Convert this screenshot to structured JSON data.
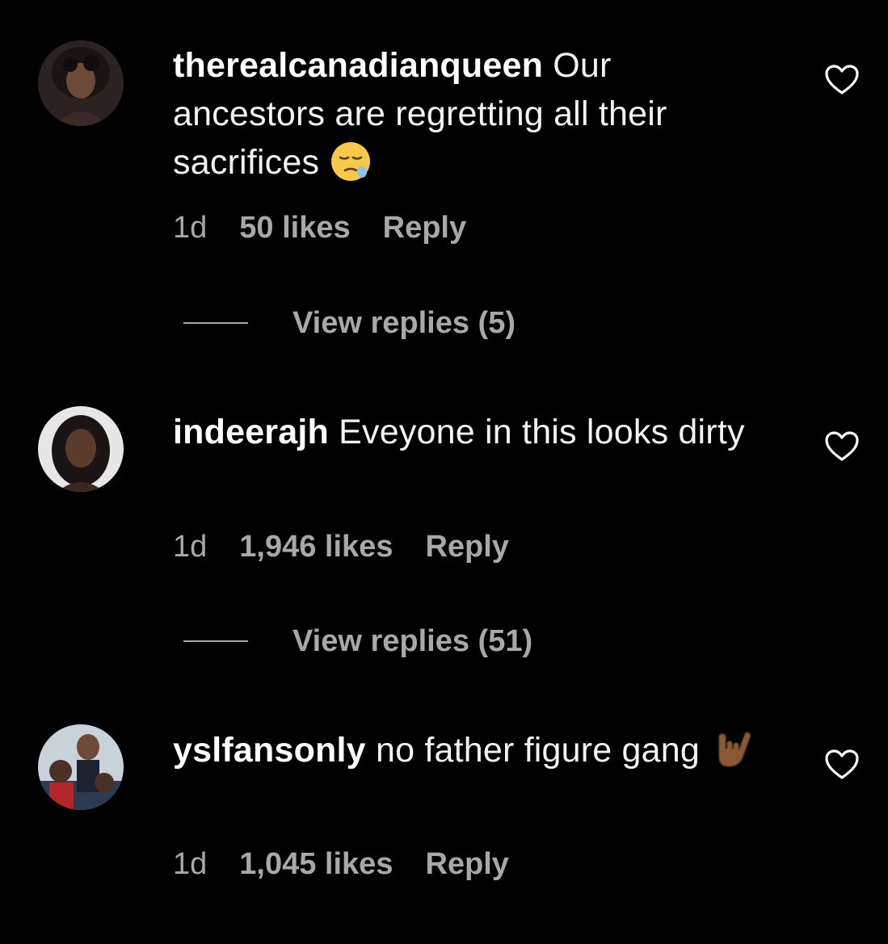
{
  "colors": {
    "background": "#000000",
    "text_primary": "#f2f2f2",
    "text_secondary": "#a8a8a8"
  },
  "comments": [
    {
      "username": "therealcanadianqueen",
      "text": "Our ancestors are regretting all their sacrifices",
      "emoji": "sleepy-face-emoji",
      "time": "1d",
      "likes": "50 likes",
      "reply_label": "Reply",
      "view_replies": "View replies (5)",
      "like_icon": "heart-outline-icon"
    },
    {
      "username": "indeerajh",
      "text": "Eveyone in this looks dirty",
      "time": "1d",
      "likes": "1,946 likes",
      "reply_label": "Reply",
      "view_replies": "View replies (51)",
      "like_icon": "heart-outline-icon"
    },
    {
      "username": "yslfansonly",
      "text": "no father figure gang",
      "emoji": "sign-of-horns-emoji",
      "time": "1d",
      "likes": "1,045 likes",
      "reply_label": "Reply",
      "like_icon": "heart-outline-icon"
    }
  ]
}
